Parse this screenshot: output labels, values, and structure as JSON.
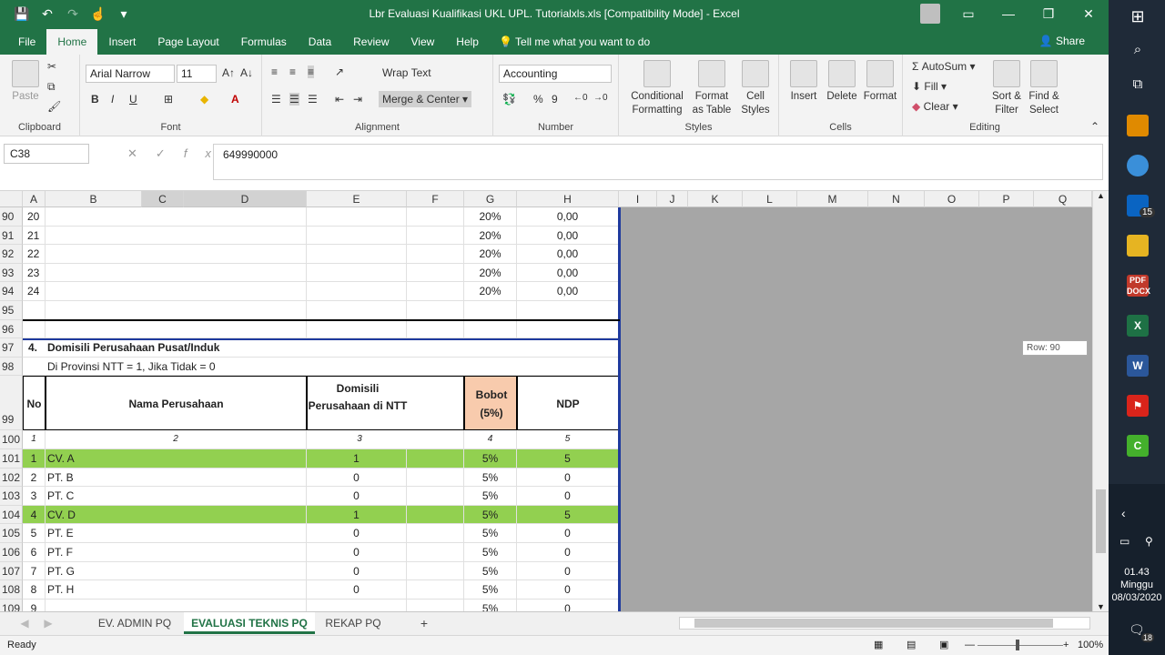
{
  "window": {
    "title": "Lbr Evaluasi Kualifikasi UKL UPL. Tutorialxls.xls  [Compatibility Mode]  -  Excel",
    "minimize": "—",
    "restore": "❐",
    "close": "✕",
    "ribbon_display": "▭"
  },
  "qat": {
    "save": "💾",
    "undo": "↶",
    "redo": "↷",
    "touch": "☝",
    "customize": "▾"
  },
  "tabs": [
    "File",
    "Home",
    "Insert",
    "Page Layout",
    "Formulas",
    "Data",
    "Review",
    "View",
    "Help"
  ],
  "tell_me": "Tell me what you want to do",
  "share": "Share",
  "ribbon": {
    "clipboard": {
      "label": "Clipboard",
      "paste": "Paste"
    },
    "font": {
      "label": "Font",
      "name": "Arial Narrow",
      "size": "11",
      "bold": "B",
      "italic": "I",
      "underline": "U"
    },
    "alignment": {
      "label": "Alignment",
      "wrap": "Wrap Text",
      "merge": "Merge & Center"
    },
    "number": {
      "label": "Number",
      "format": "Accounting",
      "percent": "%",
      "comma": "9"
    },
    "styles": {
      "label": "Styles",
      "conditional": "Conditional Formatting",
      "table": "Format as Table",
      "cell": "Cell Styles"
    },
    "cells": {
      "label": "Cells",
      "insert": "Insert",
      "delete": "Delete",
      "format": "Format"
    },
    "editing": {
      "label": "Editing",
      "autosum": "AutoSum",
      "fill": "Fill",
      "clear": "Clear",
      "sort": "Sort & Filter",
      "find": "Find & Select"
    }
  },
  "formula_bar": {
    "name_box": "C38",
    "fx": "fx",
    "value": "649990000"
  },
  "columns": [
    "A",
    "B",
    "C",
    "D",
    "E",
    "F",
    "G",
    "H",
    "I",
    "J",
    "K",
    "L",
    "M",
    "N",
    "O",
    "P",
    "Q"
  ],
  "rows_top": [
    {
      "row": "90",
      "a": "20",
      "g": "20%",
      "h": "0,00"
    },
    {
      "row": "91",
      "a": "21",
      "g": "20%",
      "h": "0,00"
    },
    {
      "row": "92",
      "a": "22",
      "g": "20%",
      "h": "0,00"
    },
    {
      "row": "93",
      "a": "23",
      "g": "20%",
      "h": "0,00"
    },
    {
      "row": "94",
      "a": "24",
      "g": "20%",
      "h": "0,00"
    },
    {
      "row": "95",
      "a": "",
      "g": "",
      "h": ""
    },
    {
      "row": "96",
      "a": "",
      "g": "",
      "h": ""
    }
  ],
  "section": {
    "row97": "97",
    "num": "4.",
    "title": "Domisili Perusahaan Pusat/Induk",
    "row98": "98",
    "note": "Di Provinsi NTT = 1, Jika Tidak = 0"
  },
  "header_row": {
    "row": "99",
    "no": "No",
    "nama": "Nama Perusahaan",
    "domisili": "Domisili Perusahaan di NTT",
    "bobot": "Bobot (5%)",
    "ndp": "NDP"
  },
  "index_row": {
    "row": "100",
    "c1": "1",
    "c2": "2",
    "c3": "3",
    "c4": "4",
    "c5": "5"
  },
  "companies": [
    {
      "row": "101",
      "no": "1",
      "name": "CV. A",
      "dom": "1",
      "bobot": "5%",
      "ndp": "5",
      "hl": true
    },
    {
      "row": "102",
      "no": "2",
      "name": "PT. B",
      "dom": "0",
      "bobot": "5%",
      "ndp": "0",
      "hl": false
    },
    {
      "row": "103",
      "no": "3",
      "name": "PT. C",
      "dom": "0",
      "bobot": "5%",
      "ndp": "0",
      "hl": false
    },
    {
      "row": "104",
      "no": "4",
      "name": "CV. D",
      "dom": "1",
      "bobot": "5%",
      "ndp": "5",
      "hl": true
    },
    {
      "row": "105",
      "no": "5",
      "name": "PT. E",
      "dom": "0",
      "bobot": "5%",
      "ndp": "0",
      "hl": false
    },
    {
      "row": "106",
      "no": "6",
      "name": "PT. F",
      "dom": "0",
      "bobot": "5%",
      "ndp": "0",
      "hl": false
    },
    {
      "row": "107",
      "no": "7",
      "name": "PT. G",
      "dom": "0",
      "bobot": "5%",
      "ndp": "0",
      "hl": false
    },
    {
      "row": "108",
      "no": "8",
      "name": "PT. H",
      "dom": "0",
      "bobot": "5%",
      "ndp": "0",
      "hl": false
    },
    {
      "row": "109",
      "no": "9",
      "name": "",
      "dom": "",
      "bobot": "5%",
      "ndp": "0",
      "hl": false
    }
  ],
  "scroll_tooltip": "Row: 90",
  "sheets": [
    "EV. ADMIN PQ",
    "EVALUASI TEKNIS PQ",
    "REKAP PQ"
  ],
  "add_sheet": "+",
  "status": {
    "ready": "Ready",
    "zoom": "100%"
  },
  "taskbar": {
    "time": "01.43",
    "day": "Minggu",
    "date": "08/03/2020",
    "mail_badge": "15",
    "notif_badge": "18"
  },
  "colors": {
    "excel_green": "#217346",
    "highlight": "#92d050",
    "bobot_fill": "#f8cbad",
    "border_blue": "#1f3a9e"
  }
}
